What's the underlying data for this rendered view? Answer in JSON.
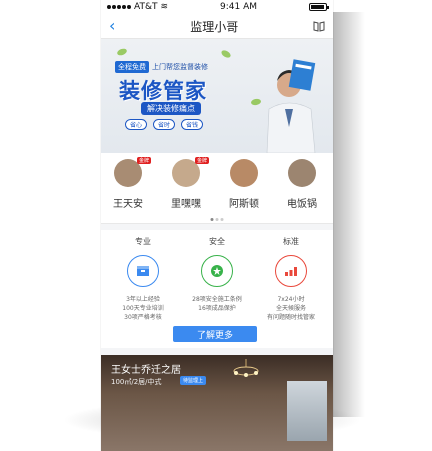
{
  "status_bar": {
    "carrier": "AT&T",
    "time": "9:41 AM",
    "battery_level": 1.0
  },
  "nav": {
    "title": "监理小哥",
    "back_icon": "chevron-left-icon",
    "right_icon": "book-icon"
  },
  "banner": {
    "badge": "全程免费",
    "subtitle": "上门帮您监督装修",
    "headline": "装修管家",
    "pill": "解决装修痛点",
    "chips": [
      "省心",
      "省时",
      "省钱"
    ]
  },
  "supervisors": [
    {
      "name": "王天安",
      "tag": "金牌"
    },
    {
      "name": "里嘿嘿",
      "tag": "金牌"
    },
    {
      "name": "阿斯顿",
      "tag": ""
    },
    {
      "name": "电饭锅",
      "tag": ""
    }
  ],
  "features": [
    {
      "label": "专业",
      "icon": "box-icon",
      "lines": [
        "3年以上经验",
        "100天专业培训",
        "30项严格考核"
      ],
      "color": "#3b8af0"
    },
    {
      "label": "安全",
      "icon": "star-icon",
      "lines": [
        "28项安全施工条例",
        "16项成品保护"
      ],
      "color": "#38b24a"
    },
    {
      "label": "标准",
      "icon": "chart-icon",
      "lines": [
        "7x24小时",
        "全天候服务",
        "有问题随时找管家"
      ],
      "color": "#e9483b"
    }
  ],
  "more_button": "了解更多",
  "project": {
    "title": "王女士乔迁之居",
    "meta": "100㎡/2居/中式",
    "tag": "待监理上"
  }
}
